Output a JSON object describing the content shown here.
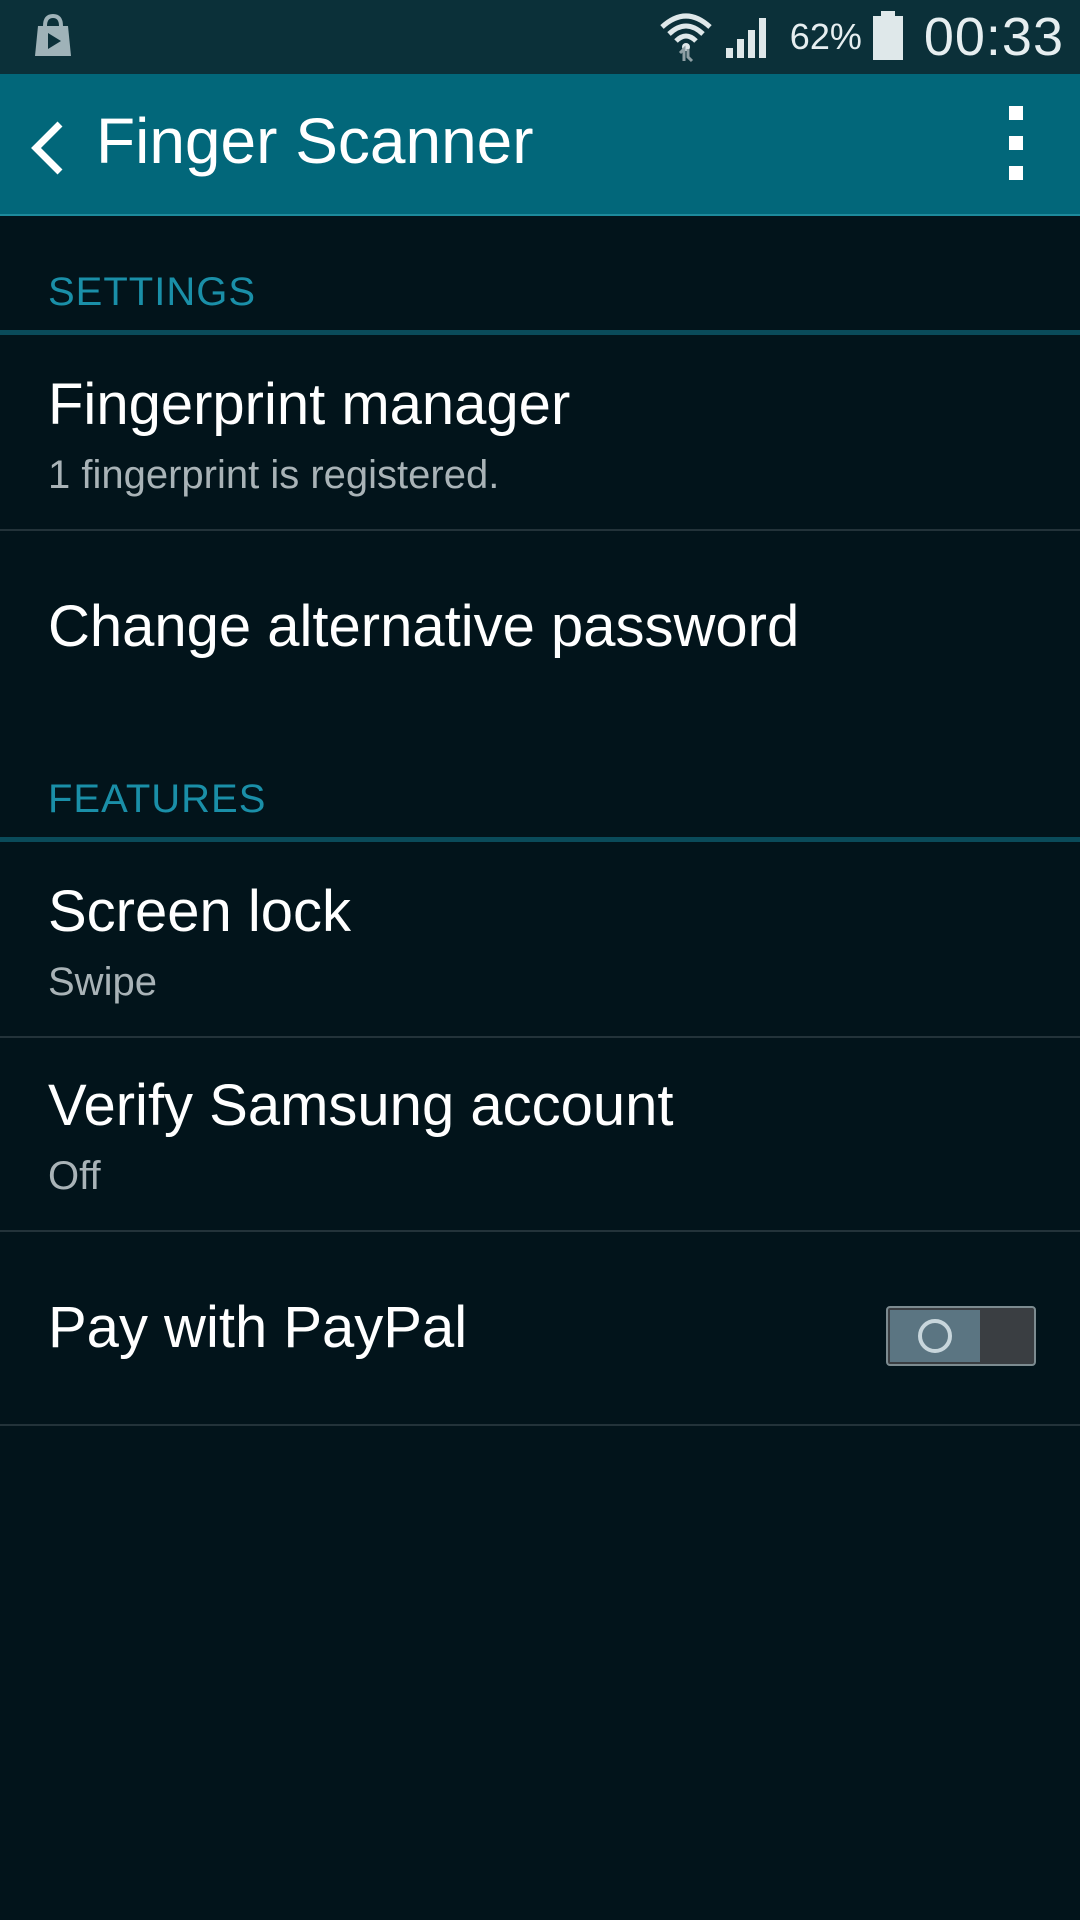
{
  "status_bar": {
    "battery_percent": "62%",
    "time": "00:33",
    "icons": [
      "play-store-icon",
      "wifi-icon",
      "cellular-signal-icon",
      "battery-icon"
    ]
  },
  "app_bar": {
    "title": "Finger Scanner",
    "back_icon": "back-chevron-icon",
    "menu_icon": "overflow-menu-icon"
  },
  "sections": {
    "settings": {
      "header": "SETTINGS",
      "items": [
        {
          "title": "Fingerprint manager",
          "subtitle": "1 fingerprint is registered."
        },
        {
          "title": "Change alternative password"
        }
      ]
    },
    "features": {
      "header": "FEATURES",
      "items": [
        {
          "title": "Screen lock",
          "subtitle": "Swipe"
        },
        {
          "title": "Verify Samsung account",
          "subtitle": "Off"
        },
        {
          "title": "Pay with PayPal",
          "toggle": "off"
        }
      ]
    }
  },
  "colors": {
    "status_bar_bg": "#0b3039",
    "app_bar_bg": "#02677a",
    "page_bg": "#02141b",
    "section_accent": "#1a8fa8"
  }
}
